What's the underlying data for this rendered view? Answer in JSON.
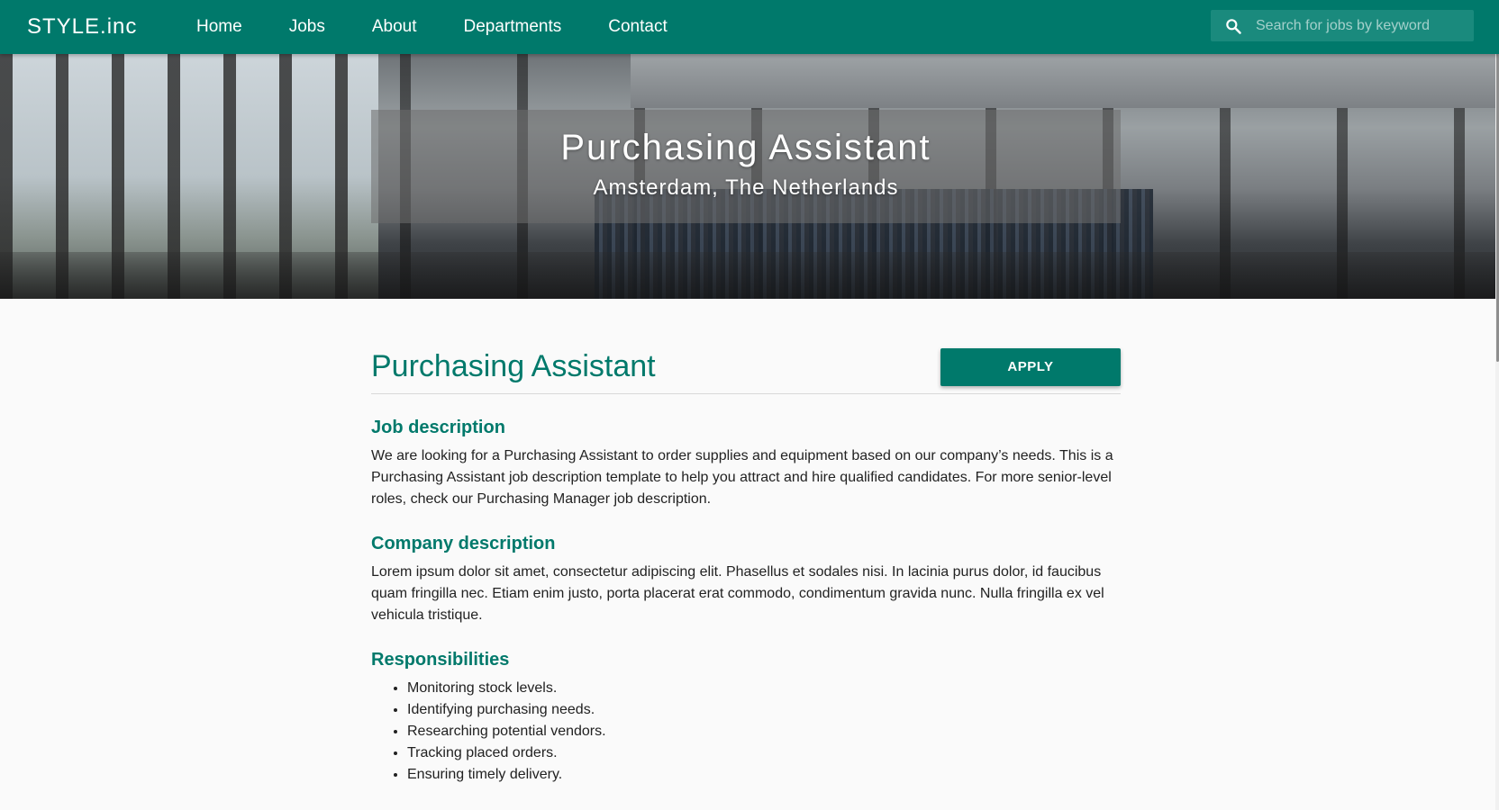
{
  "nav": {
    "brand": "STYLE.inc",
    "links": [
      "Home",
      "Jobs",
      "About",
      "Departments",
      "Contact"
    ],
    "search_placeholder": "Search for jobs by keyword",
    "accent": "#00796b"
  },
  "hero": {
    "title": "Purchasing Assistant",
    "location": "Amsterdam, The Netherlands"
  },
  "job": {
    "title": "Purchasing Assistant",
    "apply_label": "APPLY",
    "sections": {
      "description": {
        "heading": "Job description",
        "text": "We are looking for a Purchasing Assistant to order supplies and equipment based on our company’s needs. This is a Purchasing Assistant job description template to help you attract and hire qualified candidates. For more senior-level roles, check our Purchasing Manager job description."
      },
      "company": {
        "heading": "Company description",
        "text": "Lorem ipsum dolor sit amet, consectetur adipiscing elit. Phasellus et sodales nisi. In lacinia purus dolor, id faucibus quam fringilla nec. Etiam enim justo, porta placerat erat commodo, condimentum gravida nunc. Nulla fringilla ex vel vehicula tristique."
      },
      "responsibilities": {
        "heading": "Responsibilities",
        "items": [
          "Monitoring stock levels.",
          "Identifying purchasing needs.",
          "Researching potential vendors.",
          "Tracking placed orders.",
          "Ensuring timely delivery."
        ]
      }
    }
  }
}
